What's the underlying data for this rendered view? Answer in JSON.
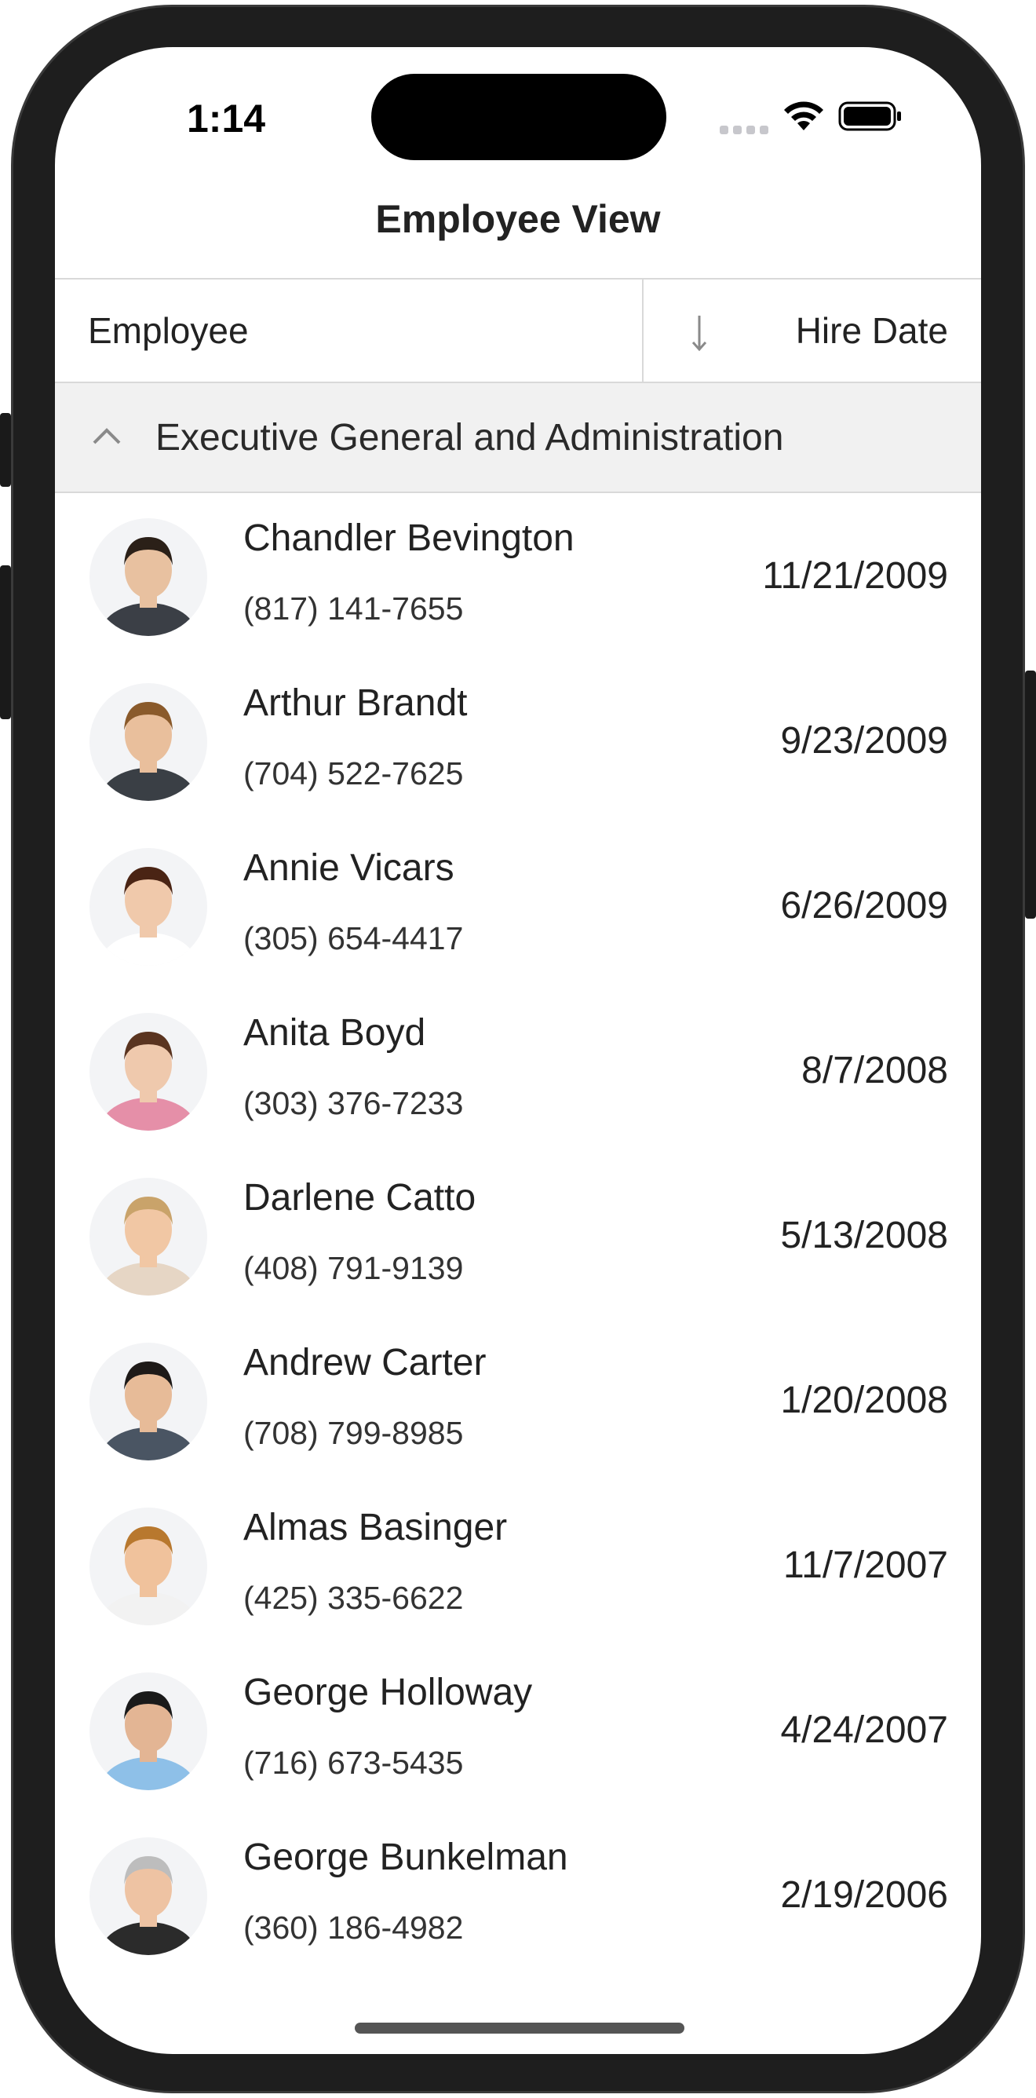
{
  "status": {
    "time": "1:14"
  },
  "nav": {
    "title": "Employee View"
  },
  "grid": {
    "columns": {
      "employee": "Employee",
      "hire_date": "Hire Date"
    },
    "sort": "descending",
    "group": {
      "label": "Executive General and Administration",
      "expanded": true
    },
    "rows": [
      {
        "name": "Chandler Bevington",
        "phone": "(817) 141-7655",
        "hire_date": "11/21/2009",
        "skin": "#e8c1a0",
        "hair": "#2b2018",
        "shirt": "#3b3f46"
      },
      {
        "name": "Arthur Brandt",
        "phone": "(704) 522-7625",
        "hire_date": "9/23/2009",
        "skin": "#e9bf9c",
        "hair": "#8a5a2b",
        "shirt": "#3a3f45"
      },
      {
        "name": "Annie Vicars",
        "phone": "(305) 654-4417",
        "hire_date": "6/26/2009",
        "skin": "#f0c9ab",
        "hair": "#4a2414",
        "shirt": "#ffffff"
      },
      {
        "name": "Anita Boyd",
        "phone": "(303) 376-7233",
        "hire_date": "8/7/2008",
        "skin": "#efc9ad",
        "hair": "#5a3420",
        "shirt": "#e58fa8"
      },
      {
        "name": "Darlene Catto",
        "phone": "(408) 791-9139",
        "hire_date": "5/13/2008",
        "skin": "#f1c7a4",
        "hair": "#c9a36a",
        "shirt": "#e6d6c5"
      },
      {
        "name": "Andrew Carter",
        "phone": "(708) 799-8985",
        "hire_date": "1/20/2008",
        "skin": "#e7bb98",
        "hair": "#1e1a18",
        "shirt": "#4a5563"
      },
      {
        "name": "Almas Basinger",
        "phone": "(425) 335-6622",
        "hire_date": "11/7/2007",
        "skin": "#f0c29c",
        "hair": "#b8782e",
        "shirt": "#f2f2f2"
      },
      {
        "name": "George Holloway",
        "phone": "(716) 673-5435",
        "hire_date": "4/24/2007",
        "skin": "#e3b594",
        "hair": "#1a1a1a",
        "shirt": "#8ec0e8"
      },
      {
        "name": "George Bunkelman",
        "phone": "(360) 186-4982",
        "hire_date": "2/19/2006",
        "skin": "#eec3a3",
        "hair": "#bdbdbd",
        "shirt": "#2b2b2b"
      }
    ]
  }
}
